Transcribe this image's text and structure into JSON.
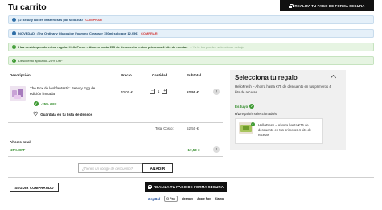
{
  "header": {
    "title": "Tu carrito",
    "checkout_label": "REALIZA TU PAGO DE FORMA SEGURA"
  },
  "notices": [
    {
      "color": "blue",
      "text": "¡2 Beauty Boxes Misteriosas por solo 30€!",
      "link": "COMPRAR"
    },
    {
      "color": "blue",
      "text": "NOVEDAD: ¡The Ordinary Glucoside Foaming Cleanser 150ml solo por 12,95€!",
      "link": "COMPRAR"
    },
    {
      "color": "green",
      "text_bold": "Has desbloqueado estos regalo: HelloFresh – Ahorra hasta €75 de descuento en tus primeros 4 kits de recetas",
      "muted": "– Ya te los puedes seleccionar debajo"
    },
    {
      "color": "green",
      "text": "Descuento aplicado -25% OFF"
    }
  ],
  "table": {
    "headers": {
      "description": "Descripción",
      "price": "Precio",
      "quantity": "Cantidad",
      "subtotal": "Subtotal"
    }
  },
  "item": {
    "name": "The Box de lookfantastic: Beauty Egg de edición limitada",
    "unit_price": "70,00 €",
    "quantity": "1",
    "minus": "−",
    "plus": "+",
    "subtotal": "52,50 €",
    "remove": "×",
    "discount_badge": "-25% OFF",
    "wishlist_label": "Guárdala en tu lista de deseos",
    "wishlist_icon": "heart-outline-icon"
  },
  "totals": {
    "label": "Total Costo:",
    "value": "52,50 €"
  },
  "savings": {
    "label": "Ahorro total:",
    "percent": "-25% OFF",
    "amount": "-17,50 €",
    "remove": "×"
  },
  "coupon": {
    "placeholder": "¿Tienes un código de descuento?",
    "apply_label": "AÑADIR"
  },
  "actions": {
    "continue_label": "SEGUIR COMPRANDO",
    "checkout_label": "REALIZA TU PAGO DE FORMA SEGURA"
  },
  "payment_methods": {
    "paypal": "PayPal",
    "gpay": "G Pay",
    "clearpay": "clearpay",
    "applepay": "Apple Pay",
    "klarna": "Klarna."
  },
  "gift_panel": {
    "title": "Selecciona tu regalo",
    "description": "HelloFresh – Ahorra hasta €75 de descuento en tus primeros 4 kits de recetas",
    "status": "Es tuyo",
    "count_bold": "0/1",
    "count_rest": " regalo/s seleccionado/s",
    "gift_name": "HelloFresh – Ahorra hasta €75 de descuento en tus primeros 4 kits de recetas"
  },
  "colors": {
    "accent_black": "#111111",
    "info_blue": "#2d6da6",
    "success_green": "#3d9a32",
    "link_red": "#d23e3e"
  }
}
